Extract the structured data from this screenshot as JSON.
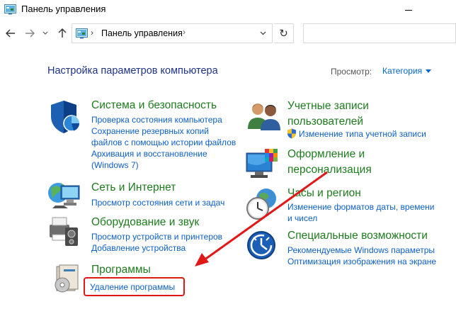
{
  "window": {
    "title": "Панель управления"
  },
  "nav": {
    "back_icon": "arrow-left-icon",
    "forward_icon": "arrow-right-icon",
    "recent_icon": "chevron-down-icon",
    "up_icon": "arrow-up-icon",
    "breadcrumb_sep": "›",
    "address": "Панель управления",
    "address_chevron": "›",
    "address_dropdown": "˅",
    "refresh_glyph": "↻",
    "search_placeholder": ""
  },
  "content": {
    "heading": "Настройка параметров компьютера",
    "view_label": "Просмотр:",
    "view_value": "Категория"
  },
  "categories": {
    "system": {
      "title": "Система и безопасность",
      "links": [
        "Проверка состояния компьютера",
        "Сохранение резервных копий",
        "файлов с помощью истории файлов",
        "Архивация и восстановление",
        "(Windows 7)"
      ]
    },
    "network": {
      "title": "Сеть и Интернет",
      "links": [
        "Просмотр состояния сети и задач"
      ]
    },
    "hardware": {
      "title": "Оборудование и звук",
      "links": [
        "Просмотр устройств и принтеров",
        "Добавление устройства"
      ]
    },
    "programs": {
      "title": "Программы",
      "links": [
        "Удаление программы"
      ]
    },
    "accounts": {
      "title_line1": "Учетные записи",
      "title_line2": "пользователей",
      "links": [
        "Изменение типа учетной записи"
      ]
    },
    "appearance": {
      "title_line1": "Оформление и",
      "title_line2": "персонализация"
    },
    "clock": {
      "title": "Часы и регион",
      "links": [
        "Изменение форматов даты, времени",
        "и чисел"
      ]
    },
    "access": {
      "title": "Специальные возможности",
      "links": [
        "Рекомендуемые Windows параметры",
        "Оптимизация изображения на экране"
      ]
    }
  },
  "colors": {
    "heading": "#1e3287",
    "category_title": "#1e7b1e",
    "link": "#0d5fc8",
    "highlight": "#e01818"
  }
}
